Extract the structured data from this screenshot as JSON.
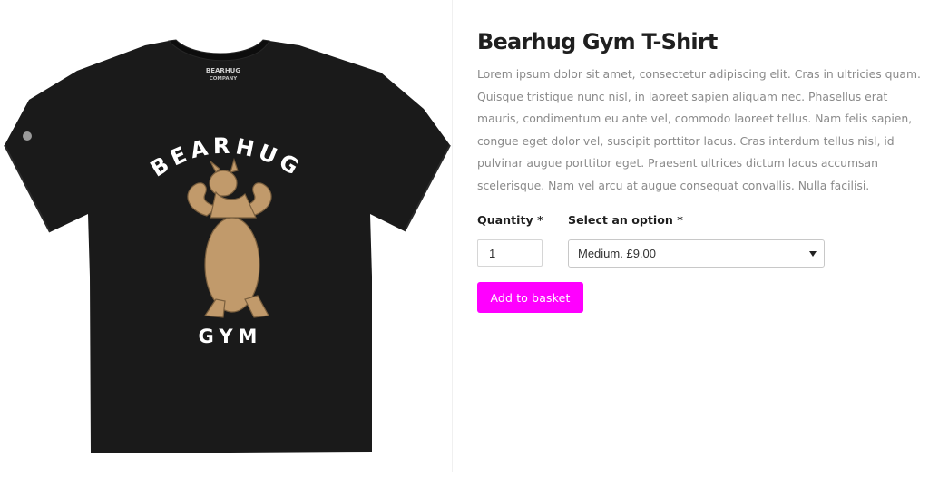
{
  "product": {
    "title": "Bearhug Gym T-Shirt",
    "description": "Lorem ipsum dolor sit amet, consectetur adipiscing elit. Cras in ultricies quam. Quisque tristique nunc nisl, in laoreet sapien aliquam nec. Phasellus erat mauris, condimentum eu ante vel, commodo laoreet tellus. Nam felis sapien, congue eget dolor vel, suscipit porttitor lacus. Cras interdum tellus nisl, id pulvinar augue porttitor eget. Praesent ultrices dictum lacus accumsan scelerisque. Nam vel arcu at augue consequat convallis. Nulla facilisi.",
    "image": {
      "shirt_color": "#1a1a1a",
      "print_top": "BEARHUG",
      "print_bottom": "GYM",
      "neck_label": "BEARHUG COMPANY",
      "bear_color": "#c19a6b",
      "icons": [
        "tshirt-icon",
        "bear-icon"
      ]
    }
  },
  "form": {
    "quantity_label": "Quantity",
    "quantity_value": "1",
    "option_label": "Select an option",
    "required_marker": "*",
    "selected_option": "Medium. £9.00",
    "add_to_basket_label": "Add to basket"
  },
  "colors": {
    "accent": "#ff00ff",
    "title": "#1f1f1f",
    "body_text": "#8a8a8a"
  }
}
